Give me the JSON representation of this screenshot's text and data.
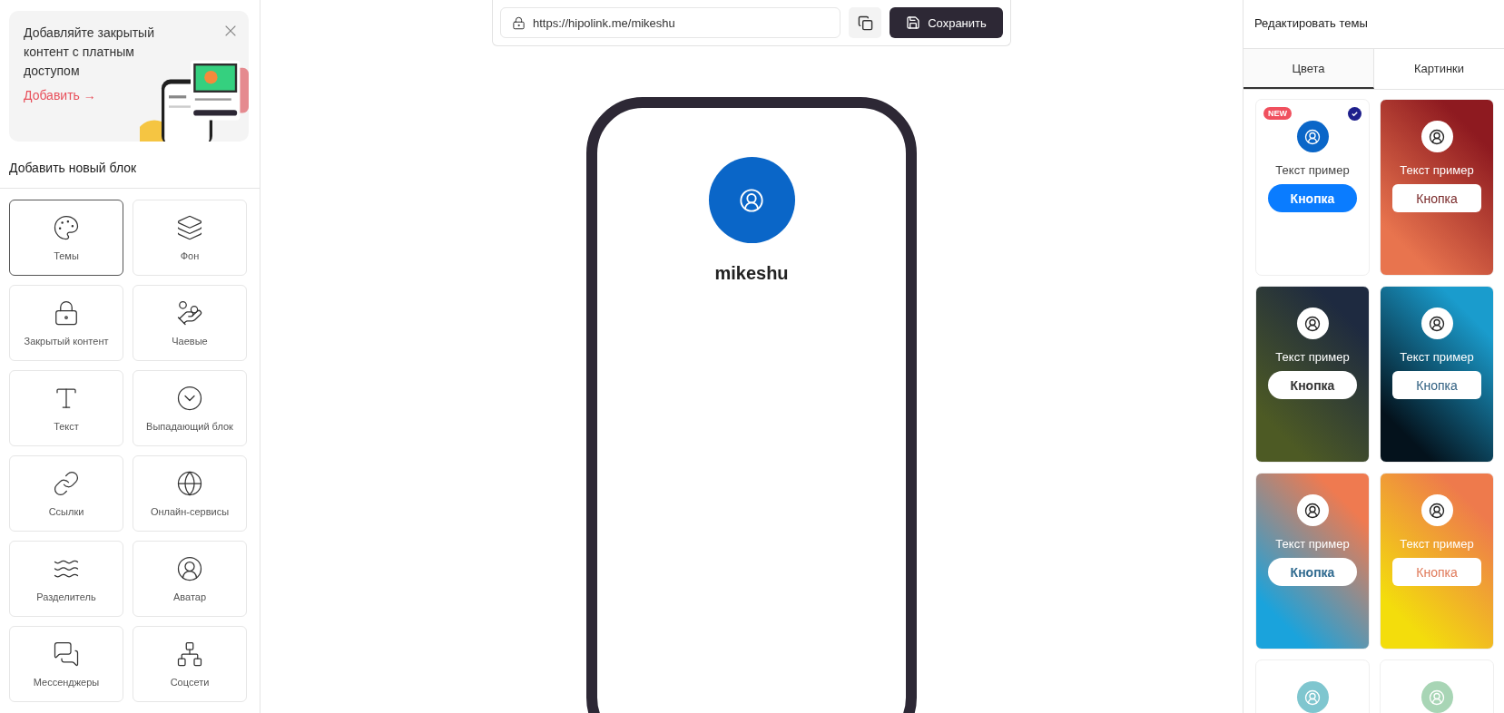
{
  "promo": {
    "title": "Добавляйте закрытый контент с платным доступом",
    "link": "Добавить →"
  },
  "blocks_heading": "Добавить новый блок",
  "blocks": [
    {
      "label": "Темы",
      "selected": true
    },
    {
      "label": "Фон",
      "selected": false
    },
    {
      "label": "Закрытый контент",
      "selected": false
    },
    {
      "label": "Чаевые",
      "selected": false
    },
    {
      "label": "Текст",
      "selected": false
    },
    {
      "label": "Выпадающий блок",
      "selected": false
    },
    {
      "label": "Ссылки",
      "selected": false
    },
    {
      "label": "Онлайн-сервисы",
      "selected": false
    },
    {
      "label": "Разделитель",
      "selected": false
    },
    {
      "label": "Аватар",
      "selected": false
    },
    {
      "label": "Мессенджеры",
      "selected": false
    },
    {
      "label": "Соцсети",
      "selected": false
    }
  ],
  "topbar": {
    "url": "https://hipolink.me/mikeshu",
    "save": "Сохранить"
  },
  "preview": {
    "name": "mikeshu",
    "avatar": {
      "color": "#0a66c8"
    }
  },
  "themes_panel": {
    "title": "Редактировать темы",
    "tabs": [
      {
        "label": "Цвета",
        "selected": true
      },
      {
        "label": "Картинки",
        "selected": false
      }
    ]
  },
  "themes": [
    {
      "badge": "NEW",
      "selected": true,
      "background": [
        {
          "color": "#ffffff"
        },
        {
          "color": "#ffffff"
        }
      ],
      "avatar": {
        "color": "#0a66c8"
      },
      "text": "Текст пример",
      "button": {
        "label": "Кнопка",
        "kind": "pill",
        "fill": {
          "color": "#0a7cff"
        },
        "ink": {
          "color": "#ffffff"
        }
      }
    },
    {
      "selected": false,
      "background": [
        {
          "color": "#8e1a20"
        },
        {
          "color": "#e8744e"
        }
      ],
      "avatar": {
        "color": "#ffffff"
      },
      "text": "Текст пример",
      "button": {
        "label": "Кнопка",
        "kind": "rounded",
        "fill": {
          "color": "#ffffff"
        },
        "ink": {
          "color": "#7a2a2a"
        }
      }
    },
    {
      "selected": false,
      "background": [
        {
          "color": "#1e2a40"
        },
        {
          "color": "#4d5a24"
        }
      ],
      "avatar": {
        "color": "#ffffff"
      },
      "text": "Текст пример",
      "button": {
        "label": "Кнопка",
        "kind": "pill",
        "fill": {
          "color": "#ffffff"
        },
        "ink": {
          "color": "#333333"
        }
      }
    },
    {
      "selected": false,
      "background": [
        {
          "color": "#1a9ccd"
        },
        {
          "color": "#04121c"
        }
      ],
      "avatar": {
        "color": "#ffffff"
      },
      "text": "Текст пример",
      "button": {
        "label": "Кнопка",
        "kind": "rounded",
        "fill": {
          "color": "#ffffff"
        },
        "ink": {
          "color": "#2f5f80"
        }
      }
    },
    {
      "selected": false,
      "background": [
        {
          "color": "#ef7a50"
        },
        {
          "color": "#1aa3dc"
        }
      ],
      "avatar": {
        "color": "#ffffff"
      },
      "text": "Текст пример",
      "button": {
        "label": "Кнопка",
        "kind": "pill",
        "fill": {
          "color": "#ffffff"
        },
        "ink": {
          "color": "#2f6a8f"
        }
      }
    },
    {
      "selected": false,
      "background": [
        {
          "color": "#ee7a4c"
        },
        {
          "color": "#f3dd0c"
        }
      ],
      "avatar": {
        "color": "#ffffff"
      },
      "text": "Текст пример",
      "button": {
        "label": "Кнопка",
        "kind": "rounded",
        "fill": {
          "color": "#ffffff"
        },
        "ink": {
          "color": "#e07a5a"
        }
      }
    },
    {
      "selected": false,
      "background": [
        {
          "color": "#ffffff"
        },
        {
          "color": "#ffffff"
        }
      ],
      "avatar": {
        "color": "#7fc6cf"
      }
    },
    {
      "selected": false,
      "background": [
        {
          "color": "#ffffff"
        },
        {
          "color": "#ffffff"
        }
      ],
      "avatar": {
        "color": "#a8d5b5"
      }
    }
  ]
}
